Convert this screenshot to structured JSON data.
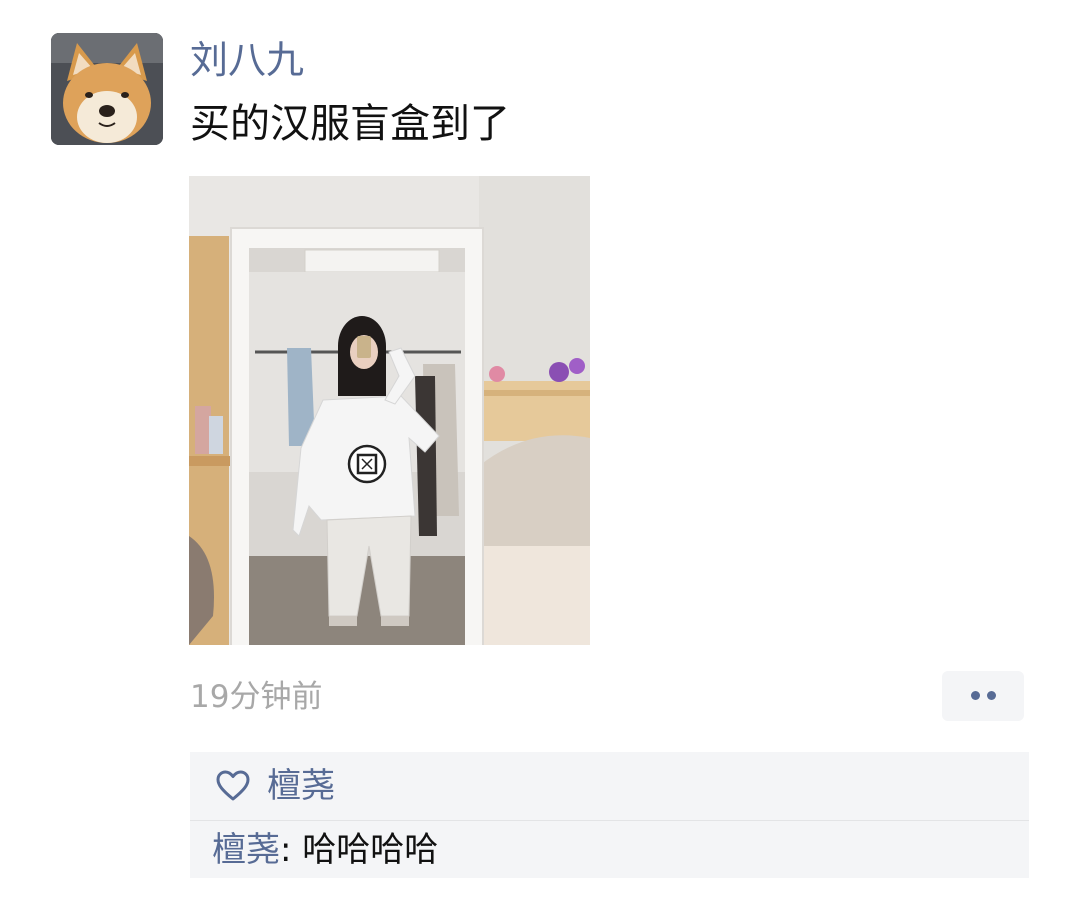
{
  "post": {
    "author": "刘八九",
    "text": "买的汉服盲盒到了",
    "time": "19分钟前"
  },
  "likes": {
    "icon": "heart-outline-icon",
    "names": "檀荛"
  },
  "comments": [
    {
      "author": "檀荛",
      "separator": ": ",
      "text": "哈哈哈哈"
    }
  ],
  "colors": {
    "link_blue": "#576b95",
    "meta_gray": "#a8a8a8",
    "panel_bg": "#f4f5f7"
  }
}
